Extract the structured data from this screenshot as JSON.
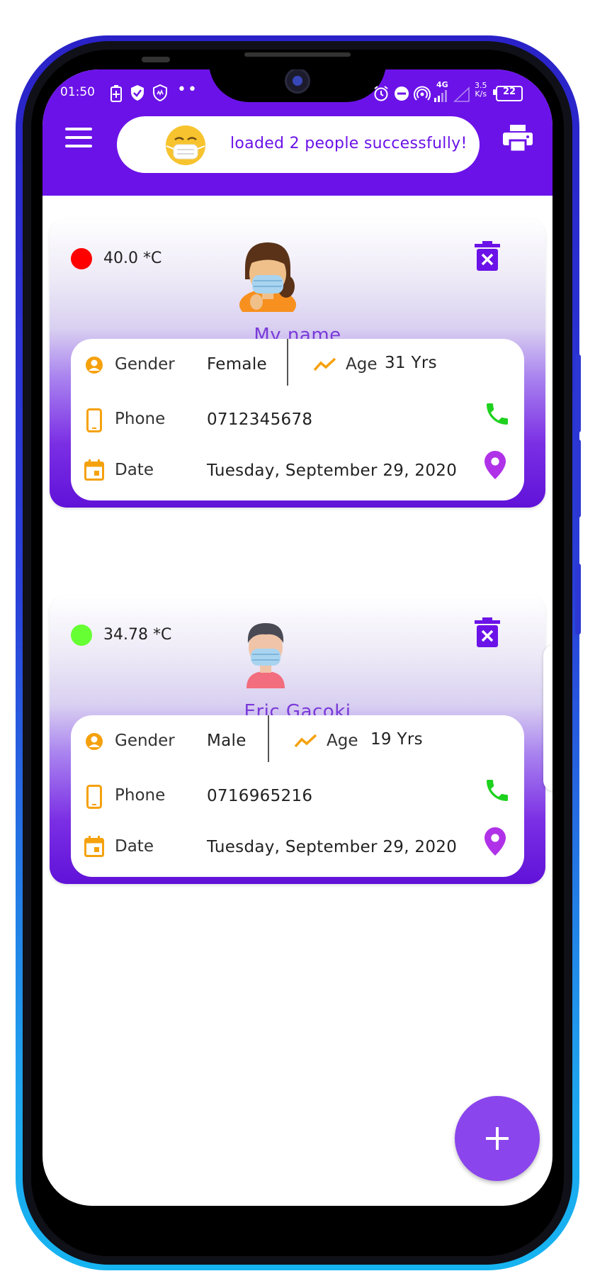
{
  "status_bar": {
    "time": "01:50",
    "network": "4G",
    "speed_value": "3.5",
    "speed_unit": "K/s",
    "battery": "22"
  },
  "toast": {
    "message": "loaded 2 people successfully!"
  },
  "people": [
    {
      "temperature": "40.0 *C",
      "temp_status_color": "#ff0000",
      "name": "My name",
      "gender_label": "Gender",
      "gender": "Female",
      "age_label": "Age",
      "age": "31 Yrs",
      "phone_label": "Phone",
      "phone": "0712345678",
      "date_label": "Date",
      "date": "Tuesday, September 29, 2020"
    },
    {
      "temperature": "34.78 *C",
      "temp_status_color": "#66ff33",
      "name": "Eric Gacoki",
      "gender_label": "Gender",
      "gender": "Male",
      "age_label": "Age",
      "age": "19 Yrs",
      "phone_label": "Phone",
      "phone": "0716965216",
      "date_label": "Date",
      "date": "Tuesday, September 29, 2020"
    }
  ],
  "colors": {
    "primary": "#6b12e8",
    "accent_orange": "#f5a10d",
    "call_green": "#1fd11f",
    "location_purple": "#b032e8",
    "fab": "#8b45ec"
  },
  "icons": [
    "menu-icon",
    "mask-emoji-icon",
    "print-icon",
    "delete-icon",
    "person-icon",
    "trend-icon",
    "phone-device-icon",
    "calendar-icon",
    "call-icon",
    "location-icon",
    "add-icon"
  ]
}
